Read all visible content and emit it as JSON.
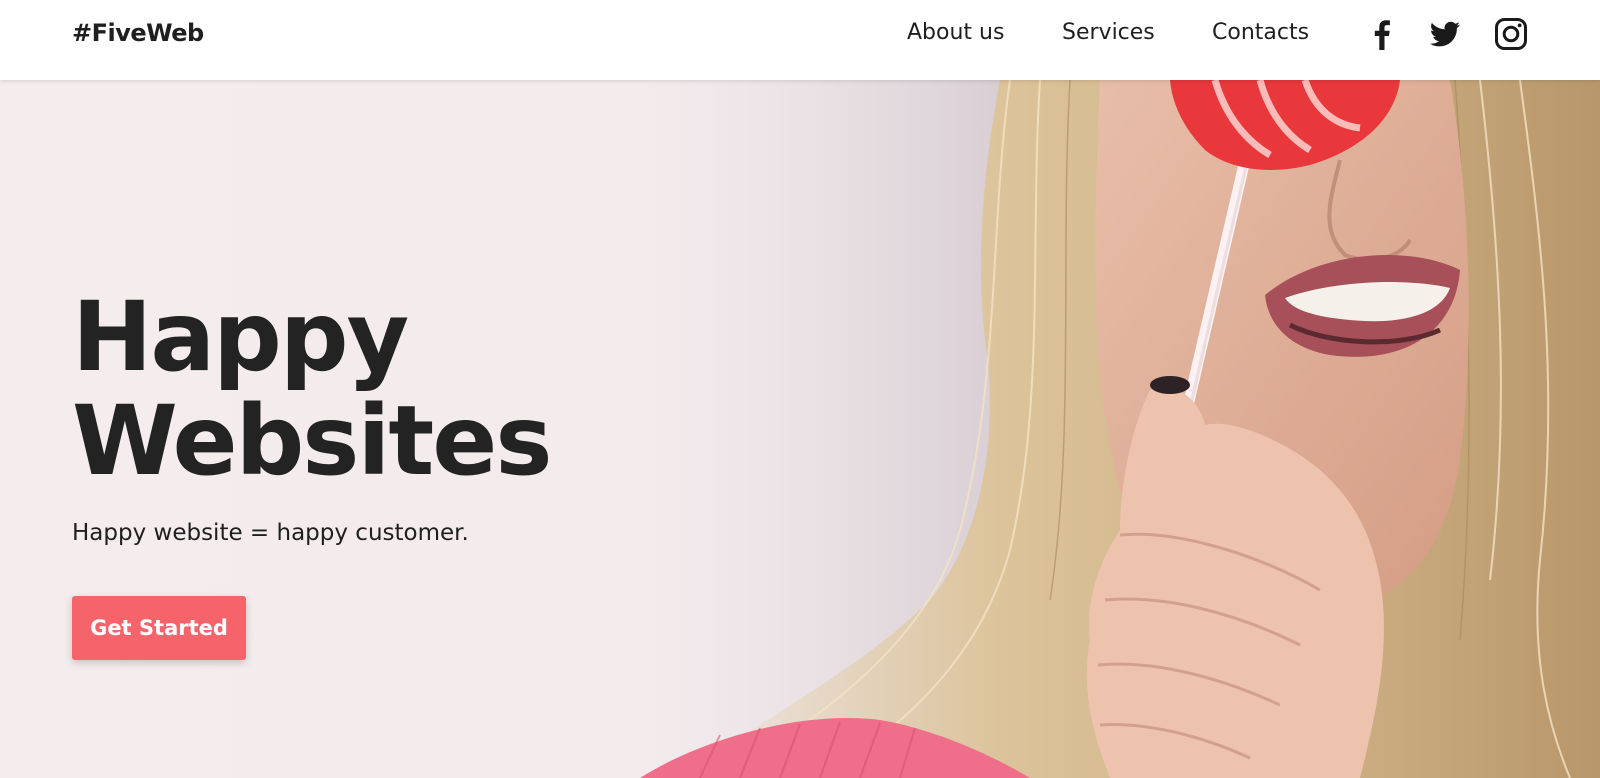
{
  "brand": {
    "logo": "#FiveWeb"
  },
  "nav": {
    "items": [
      {
        "label": "About us"
      },
      {
        "label": "Services"
      },
      {
        "label": "Contacts"
      }
    ],
    "social": [
      "facebook-icon",
      "twitter-icon",
      "instagram-icon"
    ]
  },
  "hero": {
    "title_line1": "Happy",
    "title_line2": "Websites",
    "subtitle": "Happy website = happy customer.",
    "cta_label": "Get Started",
    "image": "woman-with-lollipop-photo"
  },
  "colors": {
    "accent": "#f5646a",
    "text": "#232323",
    "hero_bg": "#f3ebec"
  }
}
